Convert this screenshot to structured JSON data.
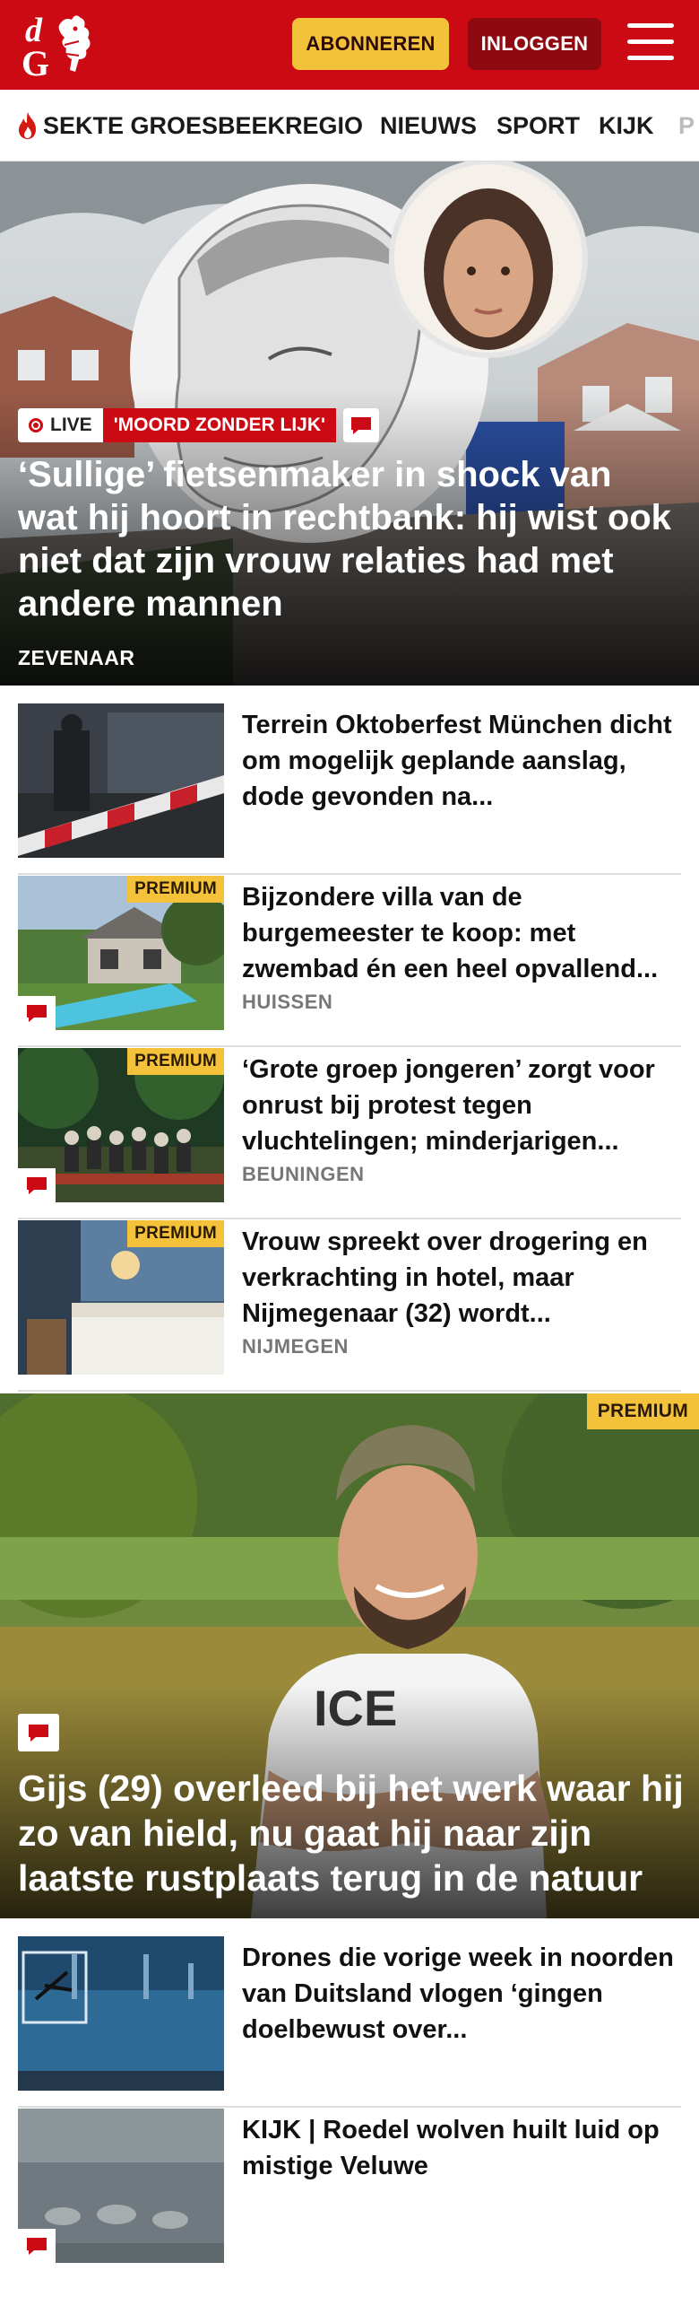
{
  "header": {
    "logo_text": "dG",
    "subscribe_label": "ABONNEREN",
    "login_label": "INLOGGEN",
    "brand_color": "#cc0a14"
  },
  "nav": {
    "items": [
      {
        "label": "SEKTE GROESBEEK",
        "icon": "flame-icon"
      },
      {
        "label": "REGIO"
      },
      {
        "label": "NIEUWS"
      },
      {
        "label": "SPORT"
      },
      {
        "label": "KIJK"
      },
      {
        "label": "P"
      }
    ]
  },
  "hero": {
    "live_label": "LIVE",
    "kicker": "'MOORD ZONDER LIJK'",
    "title": "‘Sullige’ fietsenmaker in shock van wat hij hoort in rechtbank: hij wist ook niet dat zijn vrouw relaties had met andere mannen",
    "location": "ZEVENAAR"
  },
  "articles": [
    {
      "title": "Terrein Oktoberfest München dicht om mogelijk geplande aanslag, dode gevonden na...",
      "location": "",
      "premium": false,
      "comments": false
    },
    {
      "title": "Bijzondere villa van de burgemeester te koop: met zwembad én een heel opvallend...",
      "location": "HUISSEN",
      "premium": true,
      "premium_label": "PREMIUM",
      "comments": true
    },
    {
      "title": "‘Grote groep jongeren’ zorgt voor onrust bij protest tegen vluchtelingen; minderjarigen...",
      "location": "BEUNINGEN",
      "premium": true,
      "premium_label": "PREMIUM",
      "comments": true
    },
    {
      "title": "Vrouw spreekt over drogering en verkrachting in hotel, maar Nijmegenaar (32) wordt...",
      "location": "NIJMEGEN",
      "premium": true,
      "premium_label": "PREMIUM",
      "comments": false
    },
    {
      "title": "Drones die vorige week in noorden van Duitsland vlogen ‘gingen doelbewust over...",
      "location": "",
      "premium": false,
      "comments": false
    },
    {
      "title": "KIJK | Roedel wolven huilt luid op mistige Veluwe",
      "location": "",
      "premium": false,
      "comments": true
    }
  ],
  "feature": {
    "premium_label": "PREMIUM",
    "title": "Gijs (29) overleed bij het werk waar hij zo van hield, nu gaat hij naar zijn laatste rustplaats terug in de natuur"
  }
}
